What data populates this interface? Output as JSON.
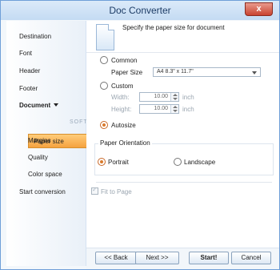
{
  "window": {
    "title": "Doc Converter",
    "close_label": "x"
  },
  "sidebar": {
    "items": [
      {
        "label": "Destination"
      },
      {
        "label": "Font"
      },
      {
        "label": "Header"
      },
      {
        "label": "Footer"
      },
      {
        "label": "Document"
      },
      {
        "label": "Paper size"
      },
      {
        "label": "Margins"
      },
      {
        "label": "Quality"
      },
      {
        "label": "Color space"
      },
      {
        "label": "Start conversion"
      }
    ]
  },
  "main": {
    "header_text": "Specify the paper size for document",
    "common_label": "Common",
    "paper_size_label": "Paper Size",
    "paper_size_value": "A4 8.3\" x 11.7\"",
    "custom_label": "Custom",
    "width_label": "Width:",
    "width_value": "10.00",
    "width_unit": "inch",
    "height_label": "Height:",
    "height_value": "10.00",
    "height_unit": "inch",
    "autosize_label": "Autosize",
    "orientation_title": "Paper Orientation",
    "portrait_label": "Portrait",
    "landscape_label": "Landscape",
    "fit_to_page_label": "Fit to Page"
  },
  "footer": {
    "back_label": "<< Back",
    "next_label": "Next >>",
    "start_label": "Start!",
    "cancel_label": "Cancel"
  },
  "watermark": "SOFTPEDIA",
  "colors": {
    "accent": "#f5a23f",
    "border": "#6f9fd8"
  }
}
